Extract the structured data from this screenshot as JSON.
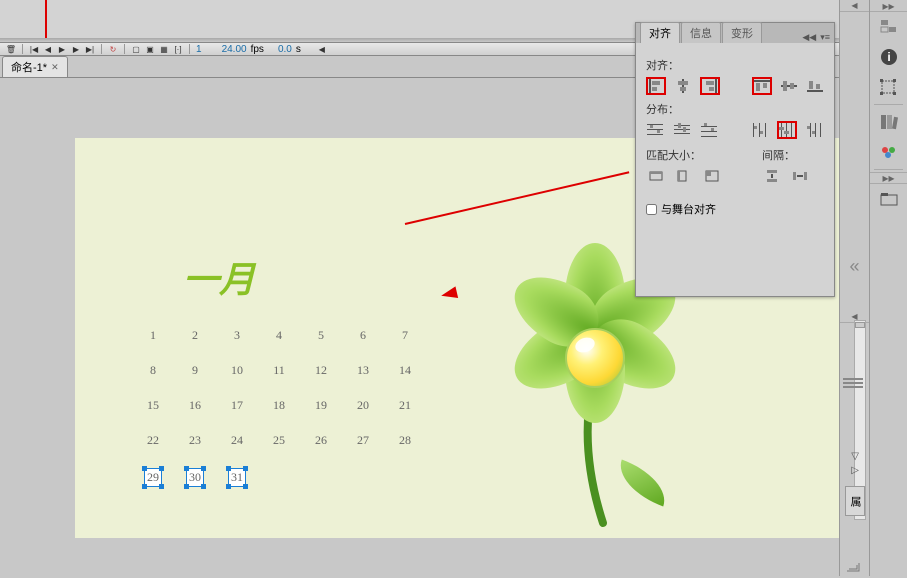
{
  "timeline": {
    "frame": "1",
    "fps": "24.00",
    "fps_unit": "fps",
    "time": "0.0",
    "time_unit": "s"
  },
  "document": {
    "tab_name": "命名-1*"
  },
  "month": {
    "title": "一月"
  },
  "calendar": {
    "rows": [
      [
        "1",
        "2",
        "3",
        "4",
        "5",
        "6",
        "7"
      ],
      [
        "8",
        "9",
        "10",
        "11",
        "12",
        "13",
        "14"
      ],
      [
        "15",
        "16",
        "17",
        "18",
        "19",
        "20",
        "21"
      ],
      [
        "22",
        "23",
        "24",
        "25",
        "26",
        "27",
        "28"
      ],
      [
        "29",
        "30",
        "31",
        "",
        "",
        "",
        ""
      ]
    ],
    "selected": [
      [
        4,
        0
      ],
      [
        4,
        1
      ],
      [
        4,
        2
      ]
    ]
  },
  "align_panel": {
    "tabs": {
      "align": "对齐",
      "info": "信息",
      "transform": "变形"
    },
    "labels": {
      "align": "对齐：",
      "distribute": "分布：",
      "match_size": "匹配大小：",
      "spacing": "间隔："
    },
    "stage_align": "与舞台对齐"
  },
  "properties_tab": "属"
}
